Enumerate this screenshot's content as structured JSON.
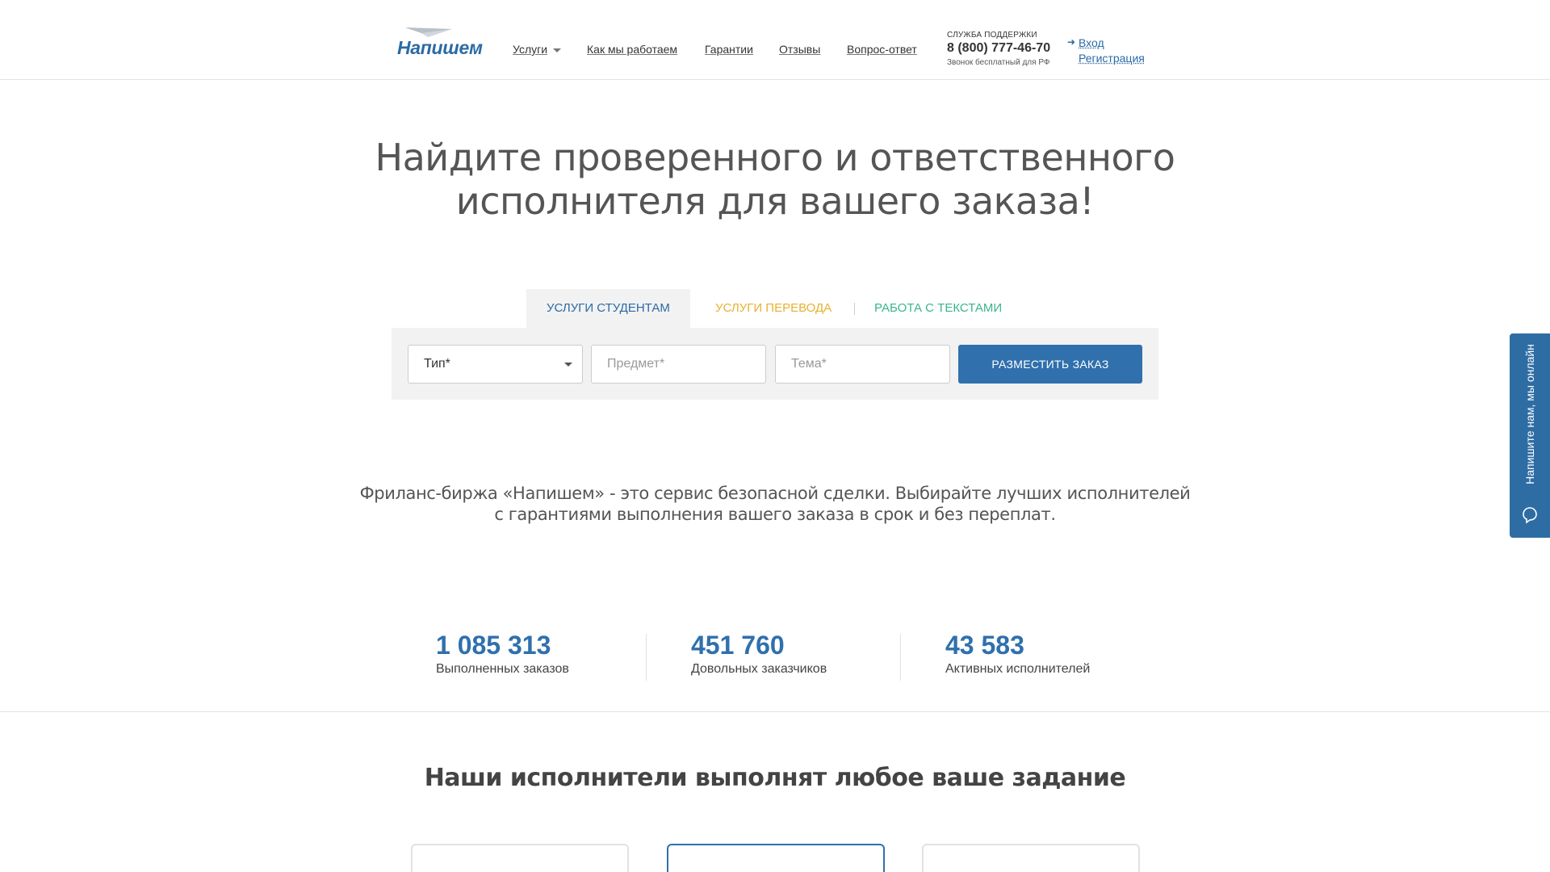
{
  "header": {
    "logo_text": "Напишем",
    "nav": [
      {
        "label": "Услуги",
        "has_dropdown": true
      },
      {
        "label": "Как мы работаем"
      },
      {
        "label": "Гарантии"
      },
      {
        "label": "Отзывы"
      },
      {
        "label": "Вопрос-ответ"
      }
    ],
    "support": {
      "title": "СЛУЖБА ПОДДЕРЖКИ",
      "phone": "8 (800) 777-46-70",
      "note": "Звонок бесплатный для РФ"
    },
    "auth": {
      "login": "Вход",
      "register": "Регистрация"
    }
  },
  "hero": {
    "title_line1": "Найдите проверенного и ответственного",
    "title_line2": "исполнителя для вашего заказа!"
  },
  "tabs": [
    {
      "label": "УСЛУГИ СТУДЕНТАМ",
      "active": true,
      "color": "#2b6aa3"
    },
    {
      "label": "УСЛУГИ ПЕРЕВОДА",
      "active": false,
      "color": "#e8b030"
    },
    {
      "label": "РАБОТА С ТЕКСТАМИ",
      "active": false,
      "color": "#3bb58c"
    }
  ],
  "order_form": {
    "type_placeholder": "Тип*",
    "subject_placeholder": "Предмет*",
    "topic_placeholder": "Тема*",
    "submit_label": "РАЗМЕСТИТЬ ЗАКАЗ"
  },
  "lead": {
    "line1": "Фриланс-биржа «Напишем» - это сервис безопасной сделки. Выбирайте лучших исполнителей",
    "line2": "с гарантиями выполнения вашего заказа в срок и без переплат."
  },
  "stats": [
    {
      "value": "1 085 313",
      "label": "Выполненных заказов"
    },
    {
      "value": "451 760",
      "label": "Довольных заказчиков"
    },
    {
      "value": "43 583",
      "label": "Активных исполнителей"
    }
  ],
  "section": {
    "title": "Наши исполнители выполнят любое ваше задание"
  },
  "chat_widget": {
    "label": "Напишите нам, мы онлайн",
    "icon": "chat-bubble-icon"
  },
  "colors": {
    "brand": "#2b6aa3",
    "button": "#2f70ad",
    "translation": "#e8b030",
    "texts": "#3bb58c"
  }
}
